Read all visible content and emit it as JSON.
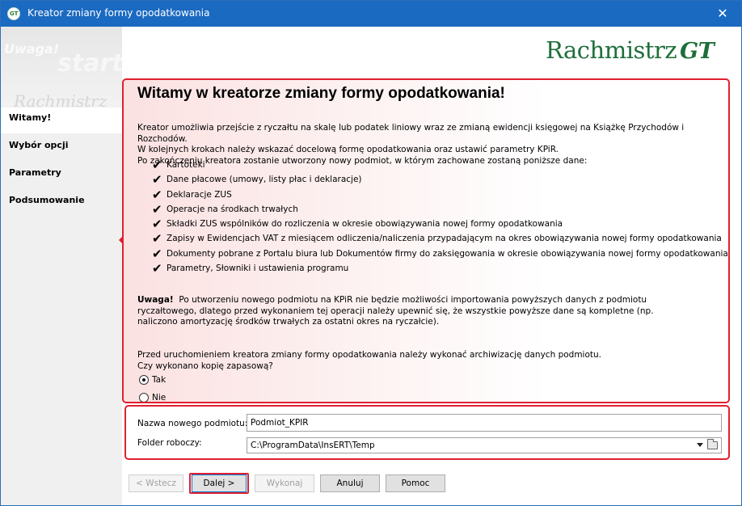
{
  "window": {
    "title": "Kreator zmiany formy opodatkowania",
    "app_icon_text": "GT"
  },
  "sidebar": {
    "bg_words": [
      "Uwaga!",
      "start",
      "Rachmistrz"
    ],
    "steps": [
      {
        "label": "Witamy!",
        "active": true
      },
      {
        "label": "Wybór opcji",
        "active": false
      },
      {
        "label": "Parametry",
        "active": false
      },
      {
        "label": "Podsumowanie",
        "active": false
      }
    ]
  },
  "logo": {
    "text": "Rachmistrz",
    "suffix": "GT",
    "color": "#1f6e3a"
  },
  "main": {
    "heading": "Witamy w kreatorze zmiany formy opodatkowania!",
    "intro": [
      "Kreator umożliwia przejście z ryczałtu na skalę lub podatek liniowy wraz ze zmianą ewidencji księgowej na Książkę Przychodów i Rozchodów.",
      "W kolejnych krokach należy wskazać docelową formę opodatkowania oraz ustawić parametry KPiR.",
      "Po zakończeniu kreatora zostanie utworzony nowy podmiot, w którym zachowane zostaną poniższe dane:"
    ],
    "checklist": [
      "Kartoteki",
      "Dane płacowe (umowy, listy płac i deklaracje)",
      "Deklaracje ZUS",
      "Operacje na środkach trwałych",
      "Składki ZUS wspólników do rozliczenia w okresie obowiązywania nowej formy opodatkowania",
      "Zapisy w Ewidencjach VAT z miesiącem odliczenia/naliczenia przypadającym na okres obowiązywania nowej formy opodatkowania",
      "Dokumenty pobrane z Portalu biura lub Dokumentów firmy do zaksięgowania w okresie obowiązywania nowej formy opodatkowania",
      "Parametry, Słowniki i ustawienia programu"
    ],
    "warning_label": "Uwaga!",
    "warning_text": "Po utworzeniu nowego podmiotu na KPiR nie będzie możliwości importowania powyższych danych z podmiotu ryczałtowego, dlatego przed wykonaniem tej operacji należy upewnić się, że wszystkie powyższe dane są kompletne (np. naliczono amortyzację środków trwałych za ostatni okres na ryczałcie).",
    "archive_lines": [
      "Przed uruchomieniem kreatora zmiany formy opodatkowania należy wykonać archiwizację danych podmiotu.",
      "Czy wykonano kopię zapasową?"
    ],
    "radio_yes": "Tak",
    "radio_no": "Nie",
    "radio_selected": "Tak"
  },
  "form": {
    "name_label": "Nazwa nowego podmiotu:",
    "name_value": "Podmiot_KPIR",
    "folder_label": "Folder roboczy:",
    "folder_value": "C:\\ProgramData\\InsERT\\Temp"
  },
  "buttons": {
    "back": "< Wstecz",
    "next": "Dalej >",
    "execute": "Wykonaj",
    "cancel": "Anuluj",
    "help": "Pomoc"
  },
  "colors": {
    "titlebar": "#1b6ac1",
    "highlight": "#e02030"
  }
}
